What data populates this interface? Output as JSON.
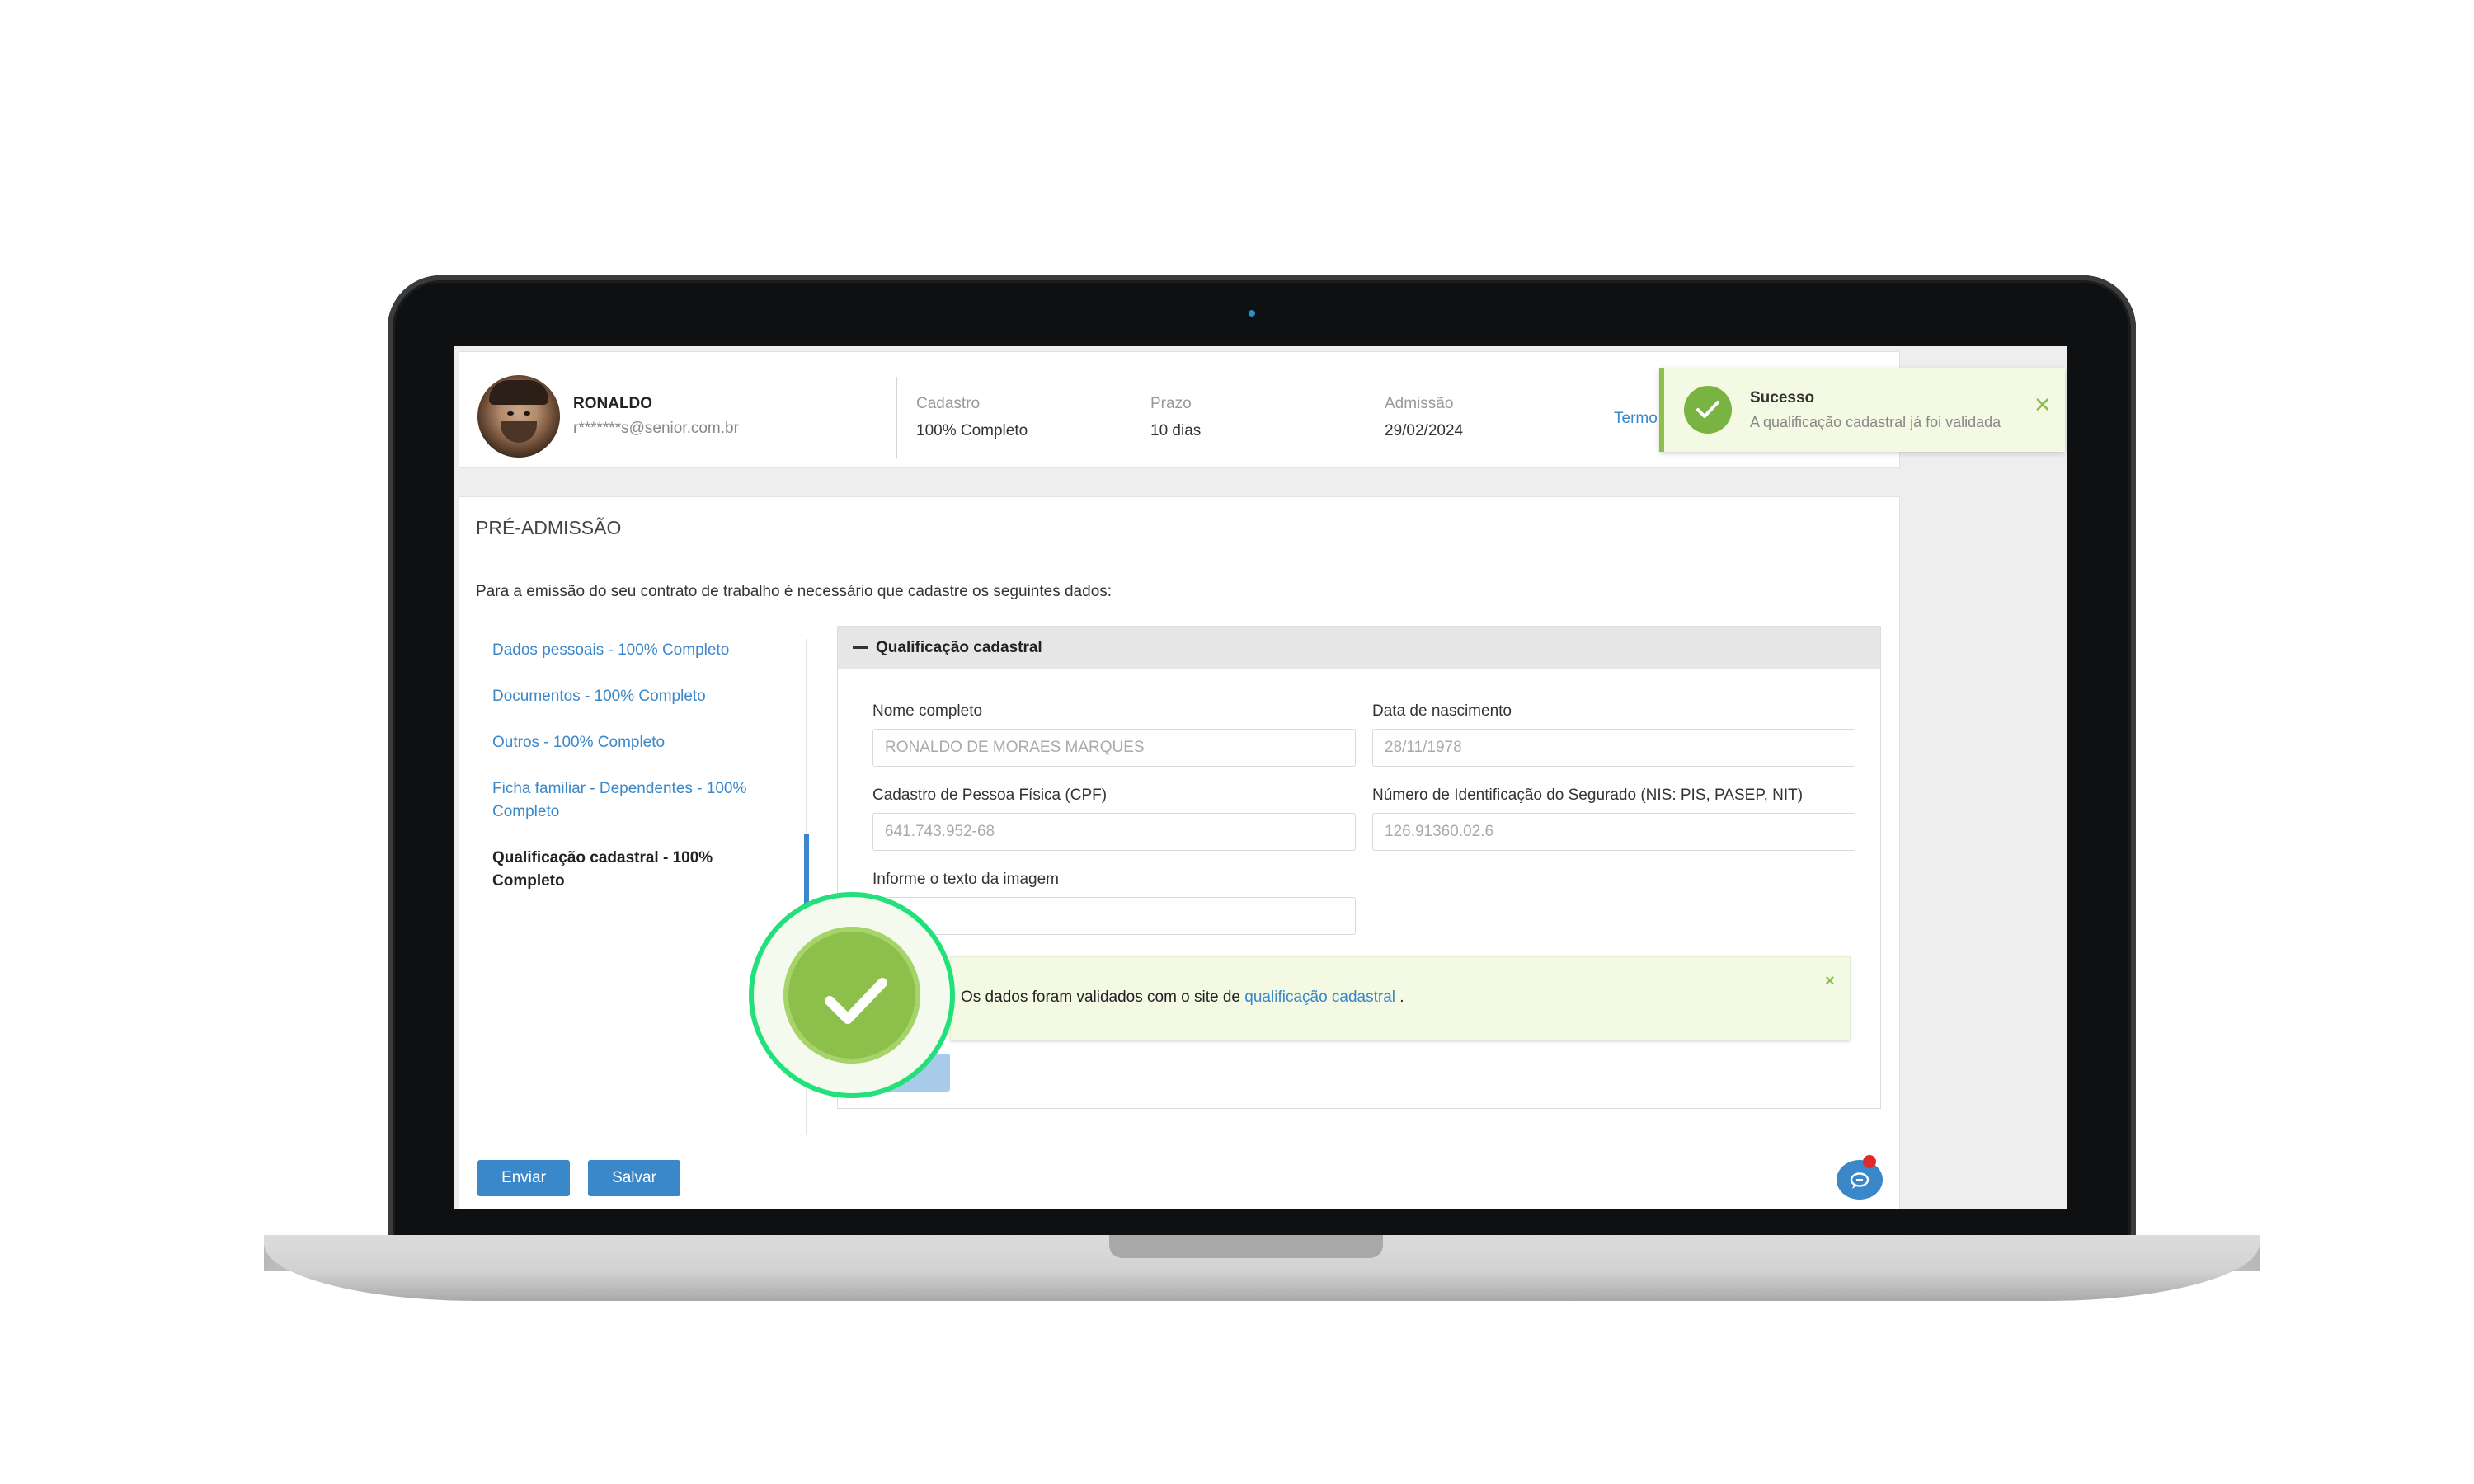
{
  "user": {
    "name": "RONALDO",
    "email": "r*******s@senior.com.br"
  },
  "summary": [
    {
      "label": "Cadastro",
      "value": "100% Completo"
    },
    {
      "label": "Prazo",
      "value": "10 dias"
    },
    {
      "label": "Admissão",
      "value": "29/02/2024"
    }
  ],
  "termo_link": "Termo",
  "toast": {
    "title": "Sucesso",
    "message": "A qualificação cadastral já foi validada",
    "close": "✕"
  },
  "page": {
    "title": "PRÉ-ADMISSÃO",
    "intro": "Para a emissão do seu contrato de trabalho é necessário que cadastre os seguintes dados:"
  },
  "nav": {
    "items": [
      {
        "label": "Dados pessoais - 100% Completo"
      },
      {
        "label": "Documentos - 100% Completo"
      },
      {
        "label": "Outros - 100% Completo"
      },
      {
        "label": "Ficha familiar - Dependentes - 100% Completo"
      },
      {
        "label": "Qualificação cadastral - 100% Completo"
      }
    ]
  },
  "panel": {
    "title": "Qualificação cadastral",
    "fields": {
      "nome_label": "Nome completo",
      "nome_value": "RONALDO DE MORAES MARQUES",
      "nasc_label": "Data de nascimento",
      "nasc_value": "28/11/1978",
      "cpf_label": "Cadastro de Pessoa Física (CPF)",
      "cpf_value": "641.743.952-68",
      "nis_label": "Número de Identificação do Segurado (NIS: PIS, PASEP, NIT)",
      "nis_value": "126.91360.02.6",
      "captcha_label": "Informe o texto da imagem",
      "captcha_value": ""
    },
    "alert": {
      "text": "Os dados foram validados com o site de",
      "link": "qualificação cadastral",
      "suffix": ".",
      "close": "×"
    }
  },
  "actions": {
    "enviar": "Enviar",
    "salvar": "Salvar"
  },
  "colors": {
    "primary": "#3a87c9",
    "success": "#8cc04a",
    "highlight_ring": "#22e07a"
  }
}
